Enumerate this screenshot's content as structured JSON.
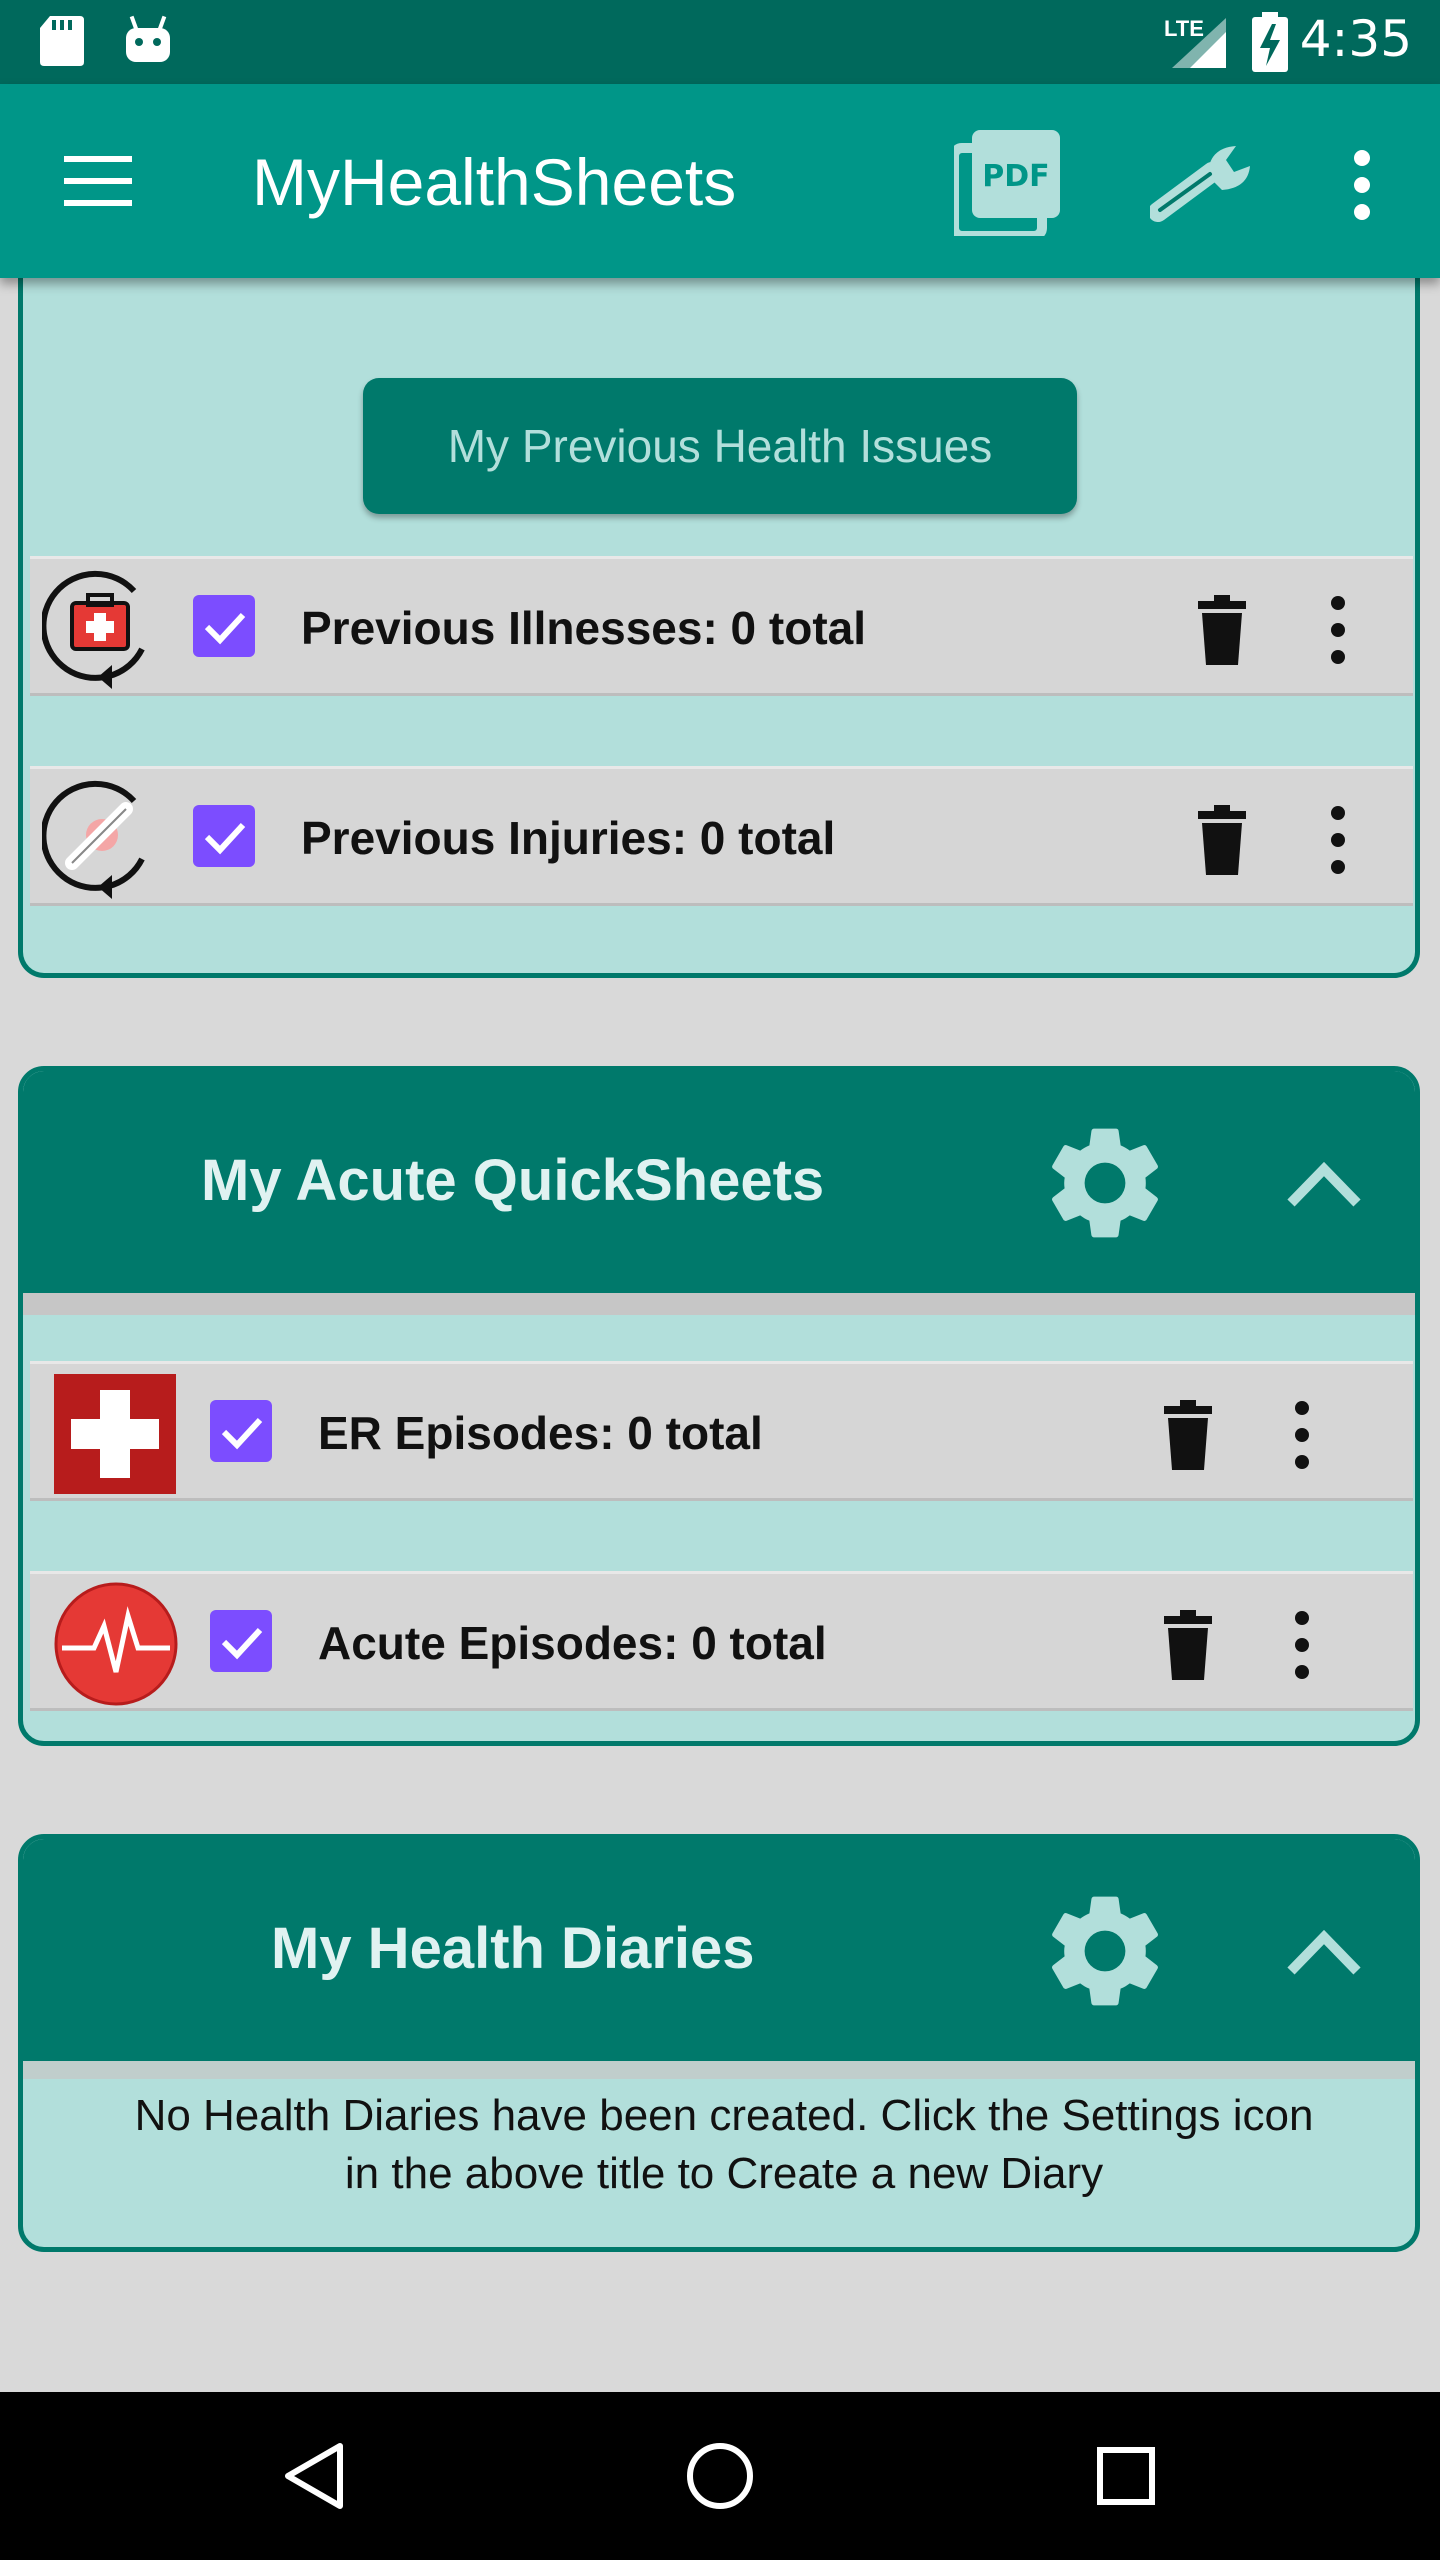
{
  "status_bar": {
    "network": "LTE",
    "time": "4:35"
  },
  "app_bar": {
    "title": "MyHealthSheets"
  },
  "previous_health": {
    "button_label": "My Previous Health Issues",
    "rows": [
      {
        "label": "Previous Illnesses: 0 total",
        "icon": "previous-illness-icon"
      },
      {
        "label": "Previous Injuries: 0 total",
        "icon": "previous-injury-icon"
      }
    ]
  },
  "acute": {
    "title": "My Acute QuickSheets",
    "rows": [
      {
        "label": "ER Episodes: 0 total",
        "icon": "er-cross-icon"
      },
      {
        "label": "Acute Episodes: 0 total",
        "icon": "heartbeat-icon"
      }
    ]
  },
  "diaries": {
    "title": "My Health Diaries",
    "empty_line1": "No Health Diaries have been created.  Click the Settings icon",
    "empty_line2": "in the above title to Create a new Diary"
  },
  "colors": {
    "primary": "#009688",
    "primary_dark": "#00796b",
    "card_bg": "#b2dfdb",
    "checkbox": "#7c4dff"
  }
}
